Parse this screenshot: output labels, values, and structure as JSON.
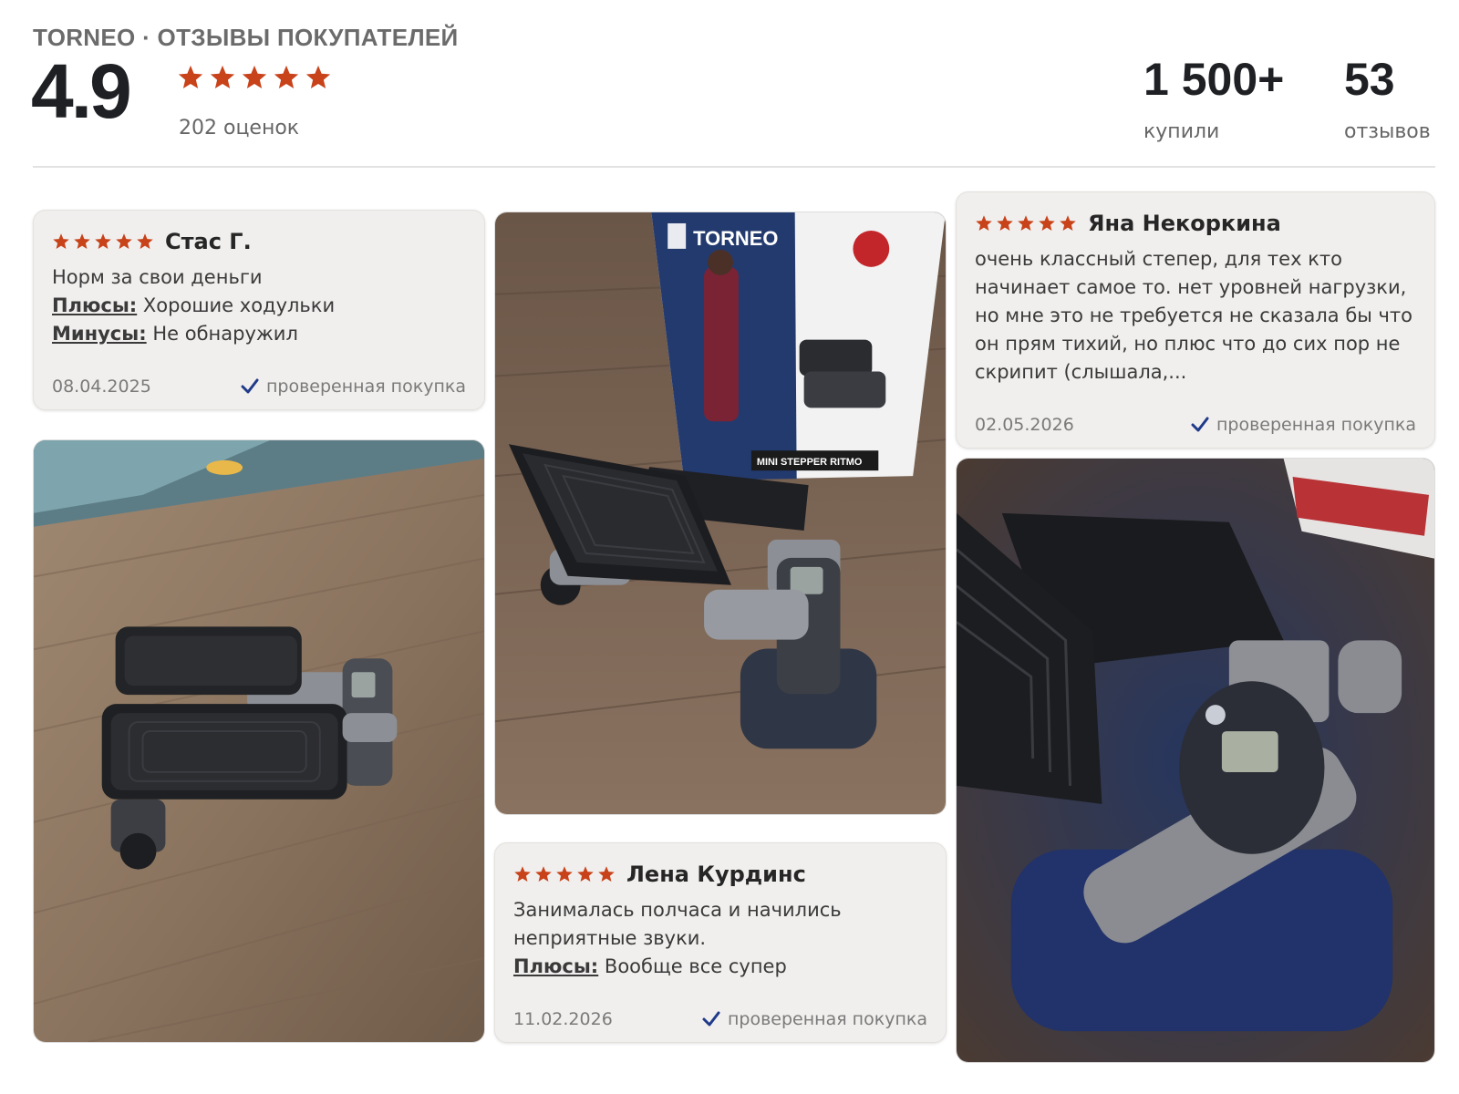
{
  "header": {
    "brand": "TORNEO · ОТЗЫВЫ ПОКУПАТЕЛЕЙ",
    "rating": "4.9",
    "ratings_count": "202 оценок",
    "bought_value": "1 500+",
    "bought_label": "купили",
    "reviews_value": "53",
    "reviews_label": "отзывов",
    "stars": 5
  },
  "colors": {
    "star": "#c8421a",
    "check": "#1f3a8a"
  },
  "reviews": [
    {
      "author": "Стас Г.",
      "stars": 5,
      "text": "Норм за свои деньги",
      "pros_label": "Плюсы:",
      "pros": "Хорошие ходульки",
      "cons_label": "Минусы:",
      "cons": "Не обнаружил",
      "date": "08.04.2025",
      "verified": "проверенная покупка"
    },
    {
      "author": "Яна Некоркина",
      "stars": 5,
      "text": "очень классный степер, для тех кто начинает самое то. нет уровней нагрузки, но мне это не требуется не сказала бы что он прям тихий, но плюс что до сих пор не скрипит (слышала,...",
      "date": "02.05.2026",
      "verified": "проверенная покупка"
    },
    {
      "author": "Лена Курдинс",
      "stars": 5,
      "text": "Занималась полчаса и начились неприятные звуки.",
      "pros_label": "Плюсы:",
      "pros": "Вообще все супер",
      "date": "11.02.2026",
      "verified": "проверенная покупка"
    }
  ],
  "box": {
    "brand": "TORNEO",
    "product": "MINI STEPPER RITMO"
  }
}
